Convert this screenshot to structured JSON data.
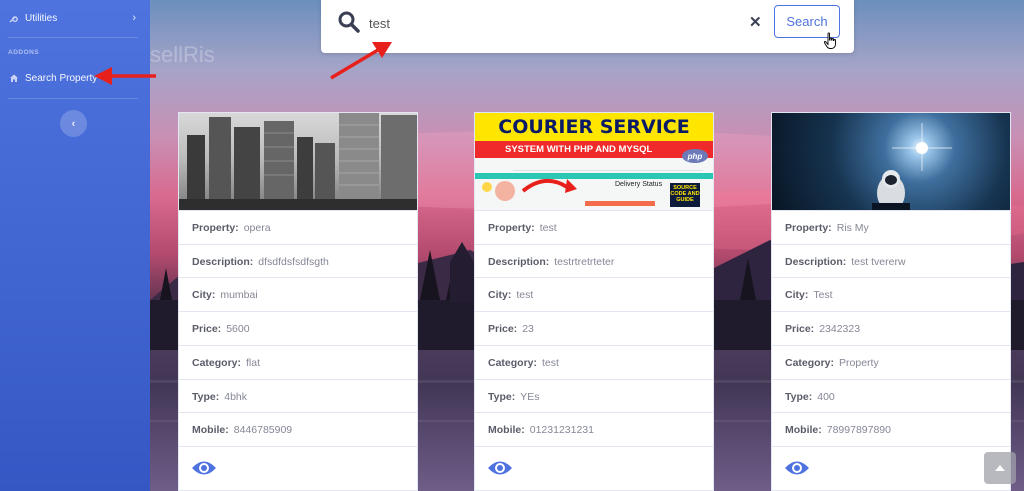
{
  "sidebar": {
    "utilities_label": "Utilities",
    "addons_heading": "ADDONS",
    "search_property_label": "Search Property"
  },
  "background": {
    "brand_text": "sellRis"
  },
  "search": {
    "value": "test",
    "button_label": "Search"
  },
  "colors": {
    "primary": "#4e73df",
    "card_label": "#5a5c69",
    "card_value": "#858796",
    "annotation_arrow": "#e8201c"
  },
  "cards": [
    {
      "image": "city-skyline",
      "property": {
        "label": "Property:",
        "value": "opera"
      },
      "description": {
        "label": "Description:",
        "value": "dfsdfdsfsdfsgth"
      },
      "city": {
        "label": "City:",
        "value": "mumbai"
      },
      "price": {
        "label": "Price:",
        "value": "5600"
      },
      "category": {
        "label": "Category:",
        "value": "flat"
      },
      "type": {
        "label": "Type:",
        "value": "4bhk"
      },
      "mobile": {
        "label": "Mobile:",
        "value": "8446785909"
      }
    },
    {
      "image": "courier-service-banner",
      "banner_title": "COURIER SERVICE",
      "banner_subtitle": "SYSTEM WITH PHP AND MYSQL",
      "banner_badge": "php",
      "banner_status": "Delivery Status",
      "banner_sticker": "SOURCE CODE AND GUIDE",
      "property": {
        "label": "Property:",
        "value": "test"
      },
      "description": {
        "label": "Description:",
        "value": "testrtretrteter"
      },
      "city": {
        "label": "City:",
        "value": "test"
      },
      "price": {
        "label": "Price:",
        "value": "23"
      },
      "category": {
        "label": "Category:",
        "value": "test"
      },
      "type": {
        "label": "Type:",
        "value": "YEs"
      },
      "mobile": {
        "label": "Mobile:",
        "value": "01231231231"
      }
    },
    {
      "image": "astronaut-space",
      "property": {
        "label": "Property:",
        "value": "Ris My"
      },
      "description": {
        "label": "Description:",
        "value": "test tvererw"
      },
      "city": {
        "label": "City:",
        "value": "Test"
      },
      "price": {
        "label": "Price:",
        "value": "2342323"
      },
      "category": {
        "label": "Category:",
        "value": "Property"
      },
      "type": {
        "label": "Type:",
        "value": "400"
      },
      "mobile": {
        "label": "Mobile:",
        "value": "78997897890"
      }
    }
  ]
}
